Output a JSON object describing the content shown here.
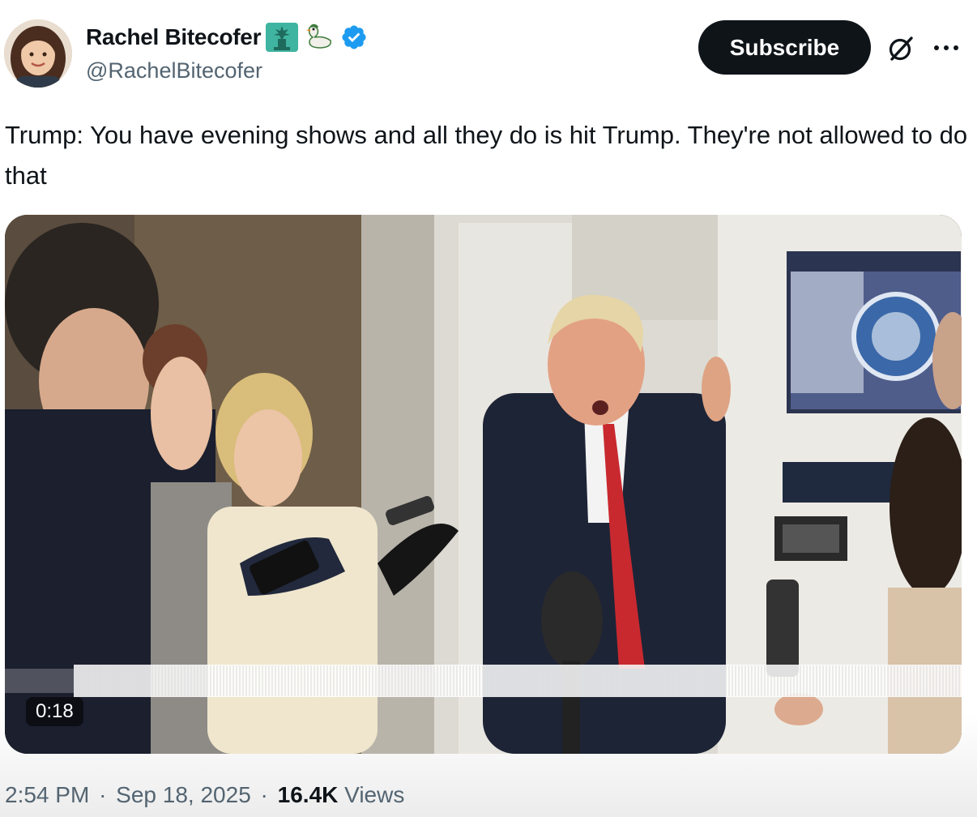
{
  "author": {
    "display_name": "Rachel Bitecofer",
    "handle": "@RachelBitecofer",
    "name_emojis": [
      "statue-of-liberty-icon",
      "duck-icon"
    ],
    "verified": true,
    "verified_color": "#1d9bf0"
  },
  "header": {
    "subscribe_label": "Subscribe",
    "grok_icon": "grok-icon",
    "more_icon": "more-icon"
  },
  "tweet": {
    "text": "Trump: You have evening shows and all they do is hit Trump. They're not allowed to do that"
  },
  "media": {
    "type": "video",
    "duration": "0:18"
  },
  "meta": {
    "time": "2:54 PM",
    "date": "Sep 18, 2025",
    "separator": "·",
    "views_count": "16.4K",
    "views_label": "Views"
  }
}
